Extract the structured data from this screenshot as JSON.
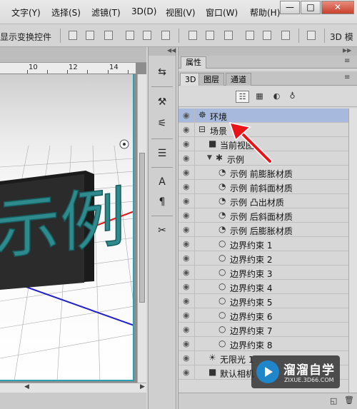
{
  "menubar": {
    "items": [
      "文字(Y)",
      "选择(S)",
      "滤镜(T)",
      "3D(D)",
      "视图(V)",
      "窗口(W)",
      "帮助(H)"
    ],
    "window_buttons": [
      "—",
      "□",
      "✕"
    ]
  },
  "options_bar": {
    "show_transform_controls": "显示变换控件",
    "mode_3d_label": "3D 模"
  },
  "document": {
    "ruler_numbers": [
      "10",
      "12",
      "14"
    ],
    "canvas_text": "示例"
  },
  "tools": {
    "icons": [
      "arrows-icon",
      "brush-icon",
      "shape-icon",
      "layers-icon",
      "text-icon",
      "paragraph-icon",
      "tools-icon"
    ]
  },
  "panel": {
    "properties_tab": "属性",
    "tabs": [
      "3D",
      "图层",
      "通道"
    ],
    "active_tab": "3D",
    "filter_icons": [
      "whole-scene-icon",
      "meshes-icon",
      "materials-icon",
      "lights-icon"
    ],
    "layers": [
      {
        "name": "环境",
        "icon": "environment-icon",
        "selected": true,
        "indent": 0
      },
      {
        "name": "场景",
        "icon": "scene-icon",
        "selected": false,
        "indent": 0
      },
      {
        "name": "当前视图",
        "icon": "camera-icon",
        "selected": false,
        "indent": 1
      },
      {
        "name": "示例",
        "icon": "mesh-icon",
        "selected": false,
        "indent": 1,
        "expanded": true
      },
      {
        "name": "示例 前膨胀材质",
        "icon": "material-icon",
        "selected": false,
        "indent": 2
      },
      {
        "name": "示例 前斜面材质",
        "icon": "material-icon",
        "selected": false,
        "indent": 2
      },
      {
        "name": "示例 凸出材质",
        "icon": "material-icon",
        "selected": false,
        "indent": 2
      },
      {
        "name": "示例 后斜面材质",
        "icon": "material-icon",
        "selected": false,
        "indent": 2
      },
      {
        "name": "示例 后膨胀材质",
        "icon": "material-icon",
        "selected": false,
        "indent": 2
      },
      {
        "name": "边界约束 1",
        "icon": "constraint-icon",
        "selected": false,
        "indent": 2
      },
      {
        "name": "边界约束 2",
        "icon": "constraint-icon",
        "selected": false,
        "indent": 2
      },
      {
        "name": "边界约束 3",
        "icon": "constraint-icon",
        "selected": false,
        "indent": 2
      },
      {
        "name": "边界约束 4",
        "icon": "constraint-icon",
        "selected": false,
        "indent": 2
      },
      {
        "name": "边界约束 5",
        "icon": "constraint-icon",
        "selected": false,
        "indent": 2
      },
      {
        "name": "边界约束 6",
        "icon": "constraint-icon",
        "selected": false,
        "indent": 2
      },
      {
        "name": "边界约束 7",
        "icon": "constraint-icon",
        "selected": false,
        "indent": 2
      },
      {
        "name": "边界约束 8",
        "icon": "constraint-icon",
        "selected": false,
        "indent": 2
      },
      {
        "name": "无限光 1",
        "icon": "infinite-light-icon",
        "selected": false,
        "indent": 1
      },
      {
        "name": "默认相机",
        "icon": "default-camera-icon",
        "selected": false,
        "indent": 1
      }
    ]
  },
  "watermark": {
    "brand": "溜溜自学",
    "site": "ZIXUE.3D66.COM"
  },
  "colors": {
    "selection": "#a7badd",
    "canvas_border": "#2aa1b5",
    "text_face": "#2f8a8d",
    "annotation_arrow": "#e8141a"
  }
}
